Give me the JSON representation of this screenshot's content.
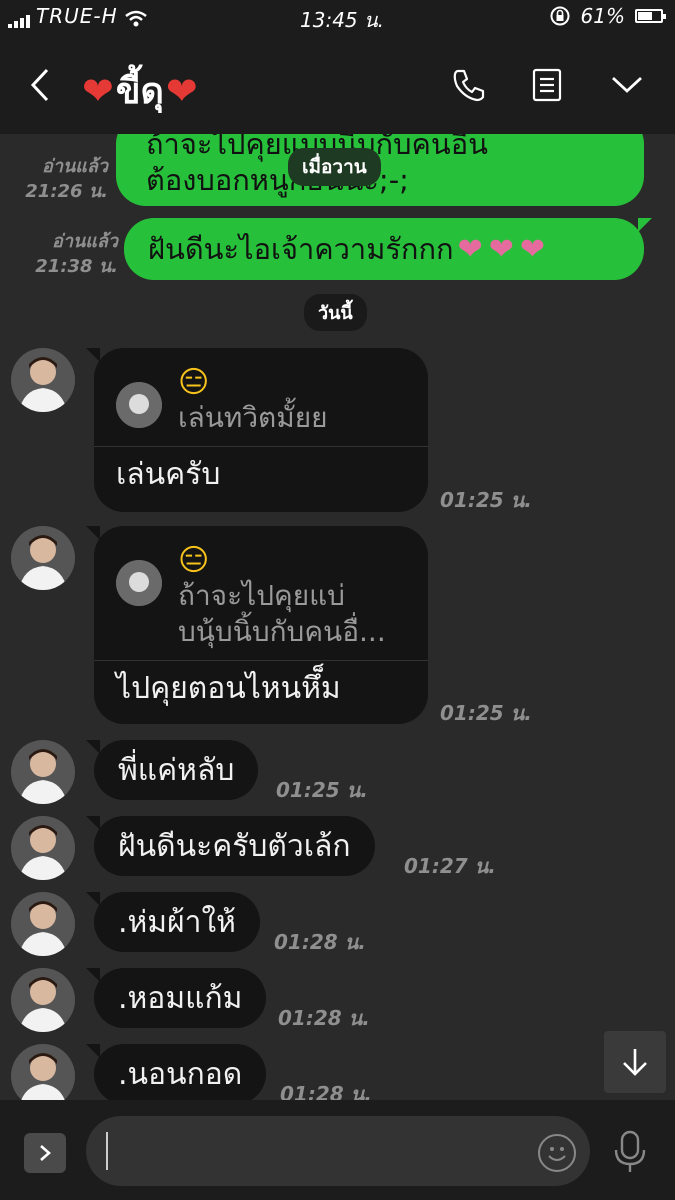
{
  "status_bar": {
    "carrier": "TRUE-H",
    "time": "13:45 น.",
    "battery": "61%",
    "battery_level": 0.61
  },
  "header": {
    "title_heart_left": "❤",
    "title": "ขี้ดุ",
    "title_heart_right": "❤",
    "icons": [
      "back-icon",
      "phone-icon",
      "notes-icon",
      "chevron-down-icon"
    ]
  },
  "messages": {
    "yesterday_pill": "เมื่อวาน",
    "today_pill": "วันนี้",
    "sent": [
      {
        "text_line1": "ถ้าจะไปคุยแบบนี้บกับคนอื่น",
        "text_line2": "ต้องบอกหนูก่อนนะ;-;",
        "read_label": "อ่านแล้ว",
        "time": "21:26 น."
      },
      {
        "text": "ฝันดีนะไอเจ้าความรักกก",
        "hearts": "❤❤❤",
        "read_label": "อ่านแล้ว",
        "time": "21:38 น."
      }
    ],
    "received_reply": [
      {
        "quote": "เล่นทวิตมั้ยย",
        "text": "เล่นครับ",
        "time": "01:25 น."
      },
      {
        "quote_line1": "ถ้าจะไปคุยแบ่",
        "quote_line2": "บนุ้บนิ้บกับคนอื่...",
        "text": "ไปคุยตอนไหนหึ็ม",
        "time": "01:25 น."
      }
    ],
    "received": [
      {
        "text": "พี่แค่หลับ",
        "time": "01:25 น."
      },
      {
        "text": "ฝันดีนะครับตัวเล้ก",
        "time": "01:27 น."
      },
      {
        "text": ".ห่มผ้าให้",
        "time": "01:28 น."
      },
      {
        "text": ".หอมแก้ม",
        "time": "01:28 น."
      },
      {
        "text": ".นอนกอด",
        "time": "01:28 น."
      }
    ]
  },
  "input": {
    "value": "",
    "placeholder": ""
  },
  "colors": {
    "sent_bubble": "#27c03a",
    "received_bubble": "#141414",
    "background": "#2a2a2a",
    "heart_red": "#e53935",
    "heart_pink": "#e56b9f"
  }
}
